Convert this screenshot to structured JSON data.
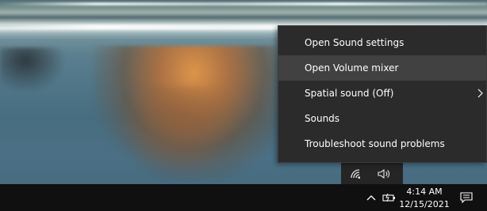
{
  "menu": {
    "items": [
      {
        "label": "Open Sound settings"
      },
      {
        "label": "Open Volume mixer"
      },
      {
        "label": "Spatial sound (Off)"
      },
      {
        "label": "Sounds"
      },
      {
        "label": "Troubleshoot sound problems"
      }
    ],
    "hovered_index": 1
  },
  "taskbar": {
    "time": "4:14 AM",
    "date": "12/15/2021",
    "icons": [
      "wifi-icon",
      "speaker-icon",
      "chevron-up-icon",
      "battery-icon",
      "notification-icon"
    ]
  },
  "colors": {
    "menu_bg": "#2b2b2b",
    "menu_hover": "#414141",
    "taskbar_bg": "#101010",
    "text": "#ffffff"
  }
}
